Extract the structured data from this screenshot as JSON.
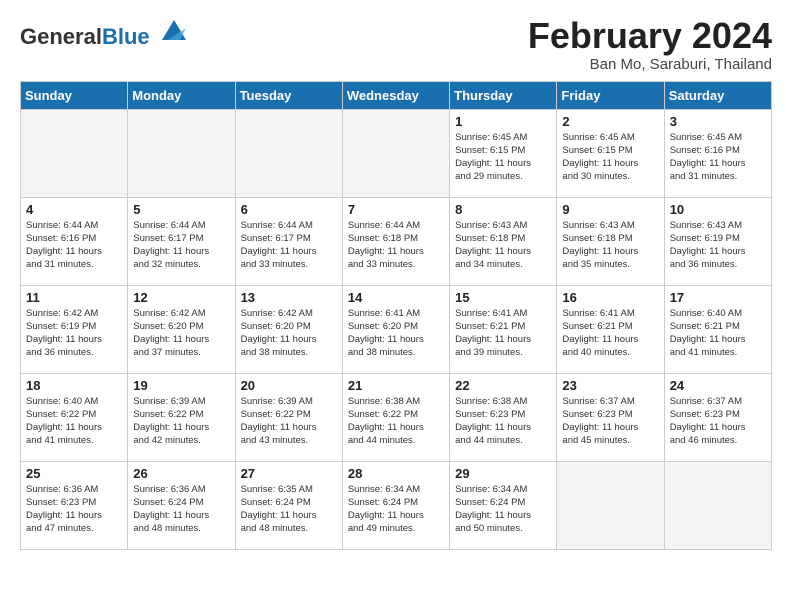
{
  "header": {
    "logo_general": "General",
    "logo_blue": "Blue",
    "month_year": "February 2024",
    "location": "Ban Mo, Saraburi, Thailand"
  },
  "days_of_week": [
    "Sunday",
    "Monday",
    "Tuesday",
    "Wednesday",
    "Thursday",
    "Friday",
    "Saturday"
  ],
  "weeks": [
    [
      {
        "day": "",
        "info": ""
      },
      {
        "day": "",
        "info": ""
      },
      {
        "day": "",
        "info": ""
      },
      {
        "day": "",
        "info": ""
      },
      {
        "day": "1",
        "info": "Sunrise: 6:45 AM\nSunset: 6:15 PM\nDaylight: 11 hours\nand 29 minutes."
      },
      {
        "day": "2",
        "info": "Sunrise: 6:45 AM\nSunset: 6:15 PM\nDaylight: 11 hours\nand 30 minutes."
      },
      {
        "day": "3",
        "info": "Sunrise: 6:45 AM\nSunset: 6:16 PM\nDaylight: 11 hours\nand 31 minutes."
      }
    ],
    [
      {
        "day": "4",
        "info": "Sunrise: 6:44 AM\nSunset: 6:16 PM\nDaylight: 11 hours\nand 31 minutes."
      },
      {
        "day": "5",
        "info": "Sunrise: 6:44 AM\nSunset: 6:17 PM\nDaylight: 11 hours\nand 32 minutes."
      },
      {
        "day": "6",
        "info": "Sunrise: 6:44 AM\nSunset: 6:17 PM\nDaylight: 11 hours\nand 33 minutes."
      },
      {
        "day": "7",
        "info": "Sunrise: 6:44 AM\nSunset: 6:18 PM\nDaylight: 11 hours\nand 33 minutes."
      },
      {
        "day": "8",
        "info": "Sunrise: 6:43 AM\nSunset: 6:18 PM\nDaylight: 11 hours\nand 34 minutes."
      },
      {
        "day": "9",
        "info": "Sunrise: 6:43 AM\nSunset: 6:18 PM\nDaylight: 11 hours\nand 35 minutes."
      },
      {
        "day": "10",
        "info": "Sunrise: 6:43 AM\nSunset: 6:19 PM\nDaylight: 11 hours\nand 36 minutes."
      }
    ],
    [
      {
        "day": "11",
        "info": "Sunrise: 6:42 AM\nSunset: 6:19 PM\nDaylight: 11 hours\nand 36 minutes."
      },
      {
        "day": "12",
        "info": "Sunrise: 6:42 AM\nSunset: 6:20 PM\nDaylight: 11 hours\nand 37 minutes."
      },
      {
        "day": "13",
        "info": "Sunrise: 6:42 AM\nSunset: 6:20 PM\nDaylight: 11 hours\nand 38 minutes."
      },
      {
        "day": "14",
        "info": "Sunrise: 6:41 AM\nSunset: 6:20 PM\nDaylight: 11 hours\nand 38 minutes."
      },
      {
        "day": "15",
        "info": "Sunrise: 6:41 AM\nSunset: 6:21 PM\nDaylight: 11 hours\nand 39 minutes."
      },
      {
        "day": "16",
        "info": "Sunrise: 6:41 AM\nSunset: 6:21 PM\nDaylight: 11 hours\nand 40 minutes."
      },
      {
        "day": "17",
        "info": "Sunrise: 6:40 AM\nSunset: 6:21 PM\nDaylight: 11 hours\nand 41 minutes."
      }
    ],
    [
      {
        "day": "18",
        "info": "Sunrise: 6:40 AM\nSunset: 6:22 PM\nDaylight: 11 hours\nand 41 minutes."
      },
      {
        "day": "19",
        "info": "Sunrise: 6:39 AM\nSunset: 6:22 PM\nDaylight: 11 hours\nand 42 minutes."
      },
      {
        "day": "20",
        "info": "Sunrise: 6:39 AM\nSunset: 6:22 PM\nDaylight: 11 hours\nand 43 minutes."
      },
      {
        "day": "21",
        "info": "Sunrise: 6:38 AM\nSunset: 6:22 PM\nDaylight: 11 hours\nand 44 minutes."
      },
      {
        "day": "22",
        "info": "Sunrise: 6:38 AM\nSunset: 6:23 PM\nDaylight: 11 hours\nand 44 minutes."
      },
      {
        "day": "23",
        "info": "Sunrise: 6:37 AM\nSunset: 6:23 PM\nDaylight: 11 hours\nand 45 minutes."
      },
      {
        "day": "24",
        "info": "Sunrise: 6:37 AM\nSunset: 6:23 PM\nDaylight: 11 hours\nand 46 minutes."
      }
    ],
    [
      {
        "day": "25",
        "info": "Sunrise: 6:36 AM\nSunset: 6:23 PM\nDaylight: 11 hours\nand 47 minutes."
      },
      {
        "day": "26",
        "info": "Sunrise: 6:36 AM\nSunset: 6:24 PM\nDaylight: 11 hours\nand 48 minutes."
      },
      {
        "day": "27",
        "info": "Sunrise: 6:35 AM\nSunset: 6:24 PM\nDaylight: 11 hours\nand 48 minutes."
      },
      {
        "day": "28",
        "info": "Sunrise: 6:34 AM\nSunset: 6:24 PM\nDaylight: 11 hours\nand 49 minutes."
      },
      {
        "day": "29",
        "info": "Sunrise: 6:34 AM\nSunset: 6:24 PM\nDaylight: 11 hours\nand 50 minutes."
      },
      {
        "day": "",
        "info": ""
      },
      {
        "day": "",
        "info": ""
      }
    ]
  ]
}
